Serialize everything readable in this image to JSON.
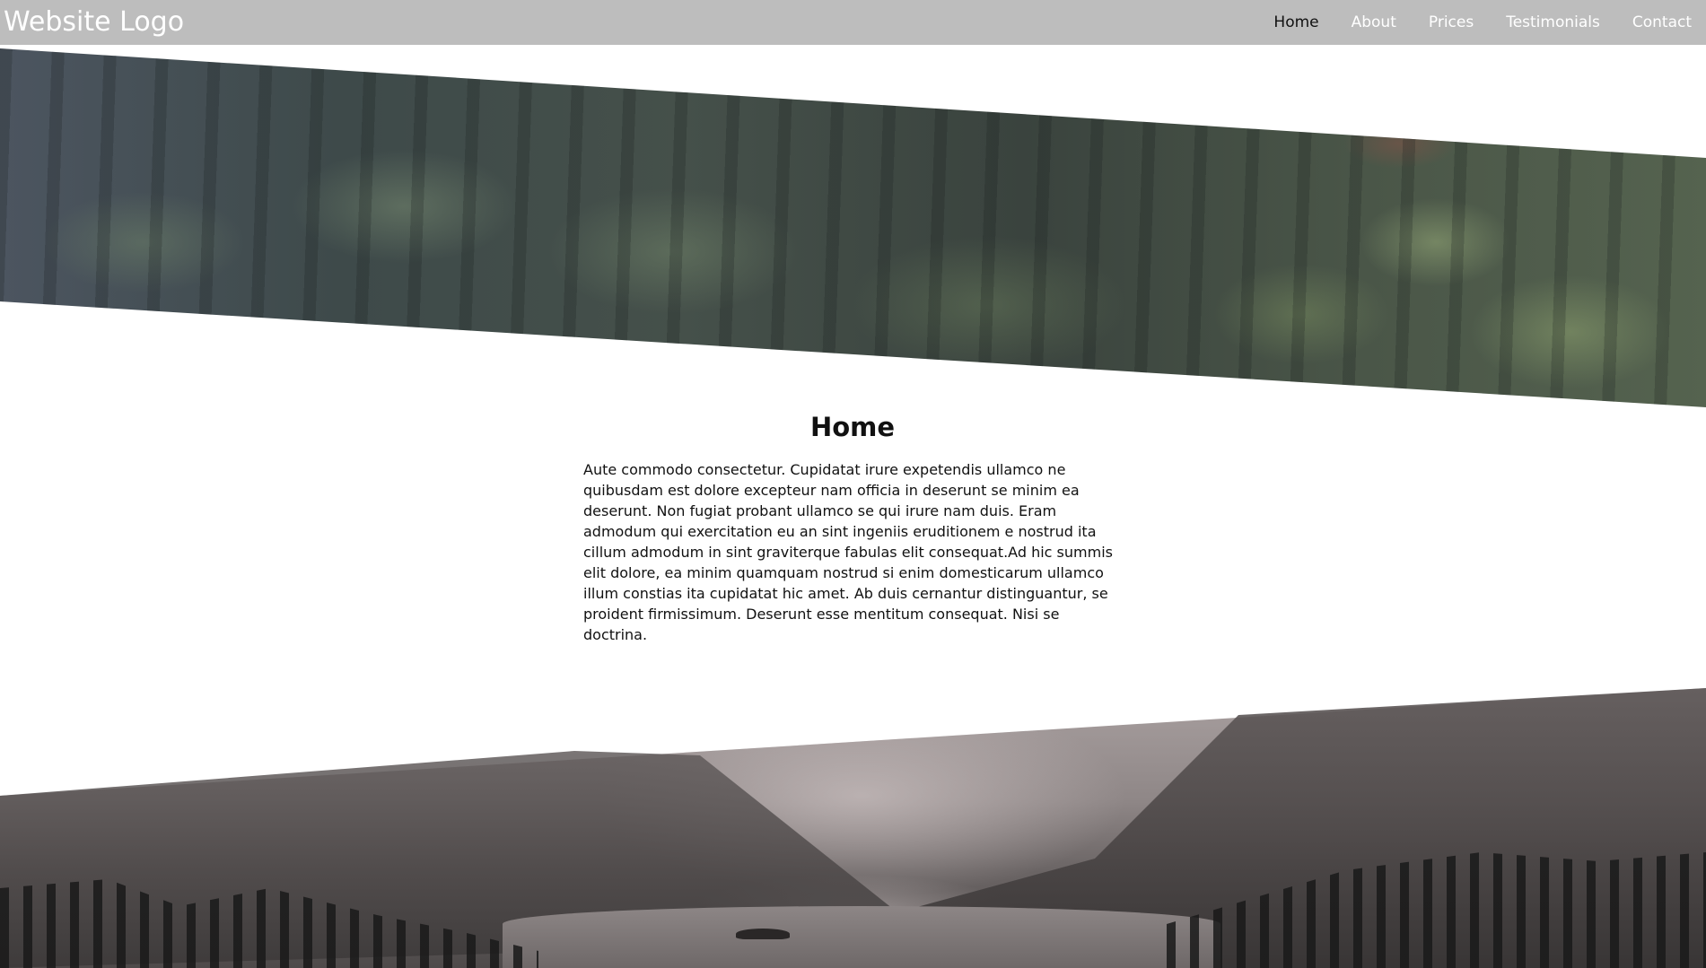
{
  "header": {
    "logo": "Website Logo",
    "nav": [
      "Home",
      "About",
      "Prices",
      "Testimonials",
      "Contact"
    ],
    "active_item": "Home"
  },
  "section": {
    "title": "Home",
    "body": "Aute commodo consectetur. Cupidatat irure expetendis ullamco ne quibusdam est dolore excepteur nam officia in deserunt se minim ea deserunt. Non fugiat probant ullamco se qui irure nam duis. Eram admodum qui exercitation eu an sint ingeniis eruditionem e nostrud ita cillum admodum in sint graviterque fabulas elit consequat.Ad hic summis elit dolore, ea minim quamquam nostrud si enim domesticarum ullamco illum constias ita cupidatat hic amet. Ab duis cernantur distinguantur, se proident firmissimum. Deserunt esse mentitum consequat. Nisi se doctrina."
  },
  "images": {
    "top": "forest-foliage-image",
    "bottom": "mountain-lake-image"
  },
  "colors": {
    "navbar_bg": "#bdbdbd",
    "nav_text": "#ffffff",
    "nav_active": "#111111",
    "page_bg": "#ffffff",
    "text": "#111111"
  }
}
